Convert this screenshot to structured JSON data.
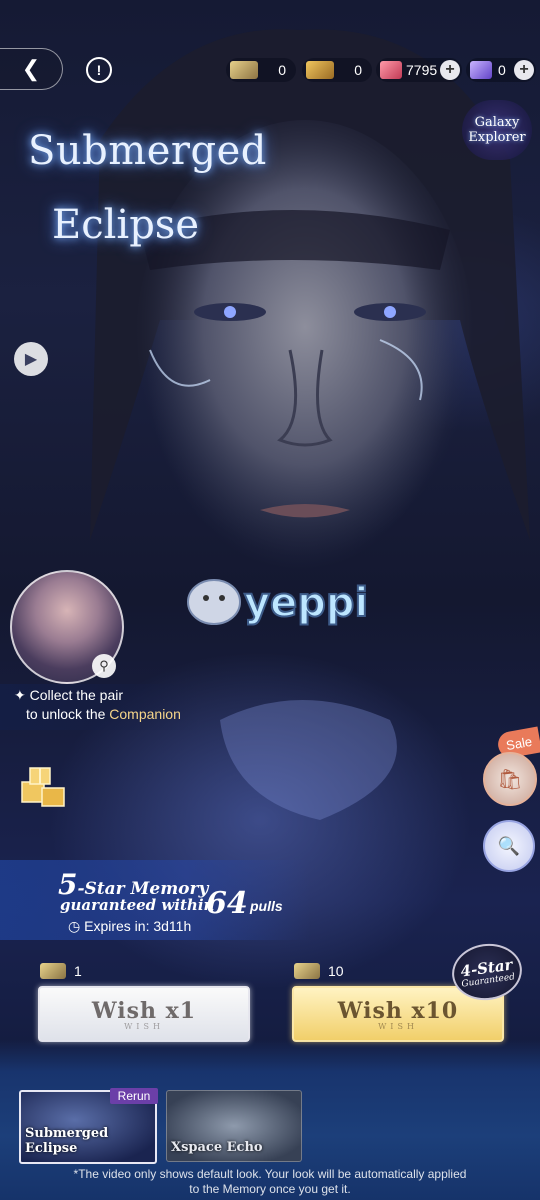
{
  "header": {
    "back_icon": "chevron-left-icon",
    "info_icon": "exclamation-icon",
    "currencies": [
      {
        "name": "ticket",
        "value": "0",
        "color": "#c9a65a"
      },
      {
        "name": "gold-ticket",
        "value": "0",
        "color": "#d9a74a"
      },
      {
        "name": "ruby",
        "value": "7795",
        "color": "#e5667a",
        "has_plus": true
      },
      {
        "name": "crystal",
        "value": "0",
        "color": "#8a6ee0",
        "has_plus": true
      }
    ]
  },
  "banner": {
    "title_line1": "Submerged",
    "title_line2": "Eclipse",
    "galaxy_line1": "Galaxy",
    "galaxy_line2": "Explorer"
  },
  "watermark": "yeppi",
  "companion": {
    "line1": "Collect the pair",
    "line2_prefix": "to unlock the",
    "line2_highlight": "Companion"
  },
  "side_buttons": {
    "sale_label": "Sale"
  },
  "guarantee": {
    "star": "5",
    "line1": "-Star Memory",
    "line2": "guaranteed within",
    "count": "64",
    "suffix": "pulls",
    "expires": "Expires in: 3d11h"
  },
  "wish": {
    "single": {
      "label": "Wish x1",
      "sub": "WISH",
      "cost": "1"
    },
    "ten": {
      "label": "Wish x10",
      "sub": "WISH",
      "cost": "10"
    },
    "badge_line1": "4-Star",
    "badge_line2": "Guaranteed"
  },
  "tabs": [
    {
      "label": "Submerged Eclipse",
      "badge": "Rerun"
    },
    {
      "label": "Xspace Echo"
    }
  ],
  "disclaimer_line1": "*The video only shows default look. Your look will be automatically applied",
  "disclaimer_line2": "to the Memory once you get it."
}
